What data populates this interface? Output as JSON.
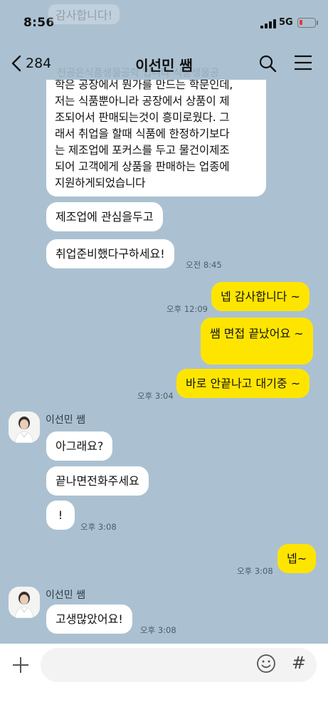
{
  "status_bar": {
    "time": "8:56",
    "network": "5G",
    "notification_ghost": "감사합니다!",
    "colors": {
      "battery_low": "#e53935"
    }
  },
  "header": {
    "back_count": "284",
    "title": "이선민 쌤",
    "overlay_ghost": "전공은식품생물공학 입니다 식품생물공"
  },
  "colors": {
    "background": "#abc1d1",
    "incoming_bubble": "#ffffff",
    "outgoing_bubble": "#fee500"
  },
  "messages": {
    "long_text": [
      "학은 공장에서 뭔가를 만드는 학문인데,",
      "저는 식품뿐아니라 공장에서 상품이 제",
      "조되어서 판매되는것이 흥미로웠다. 그",
      "래서 취업을 할때 식품에 한정하기보다",
      "는 제조업에 포커스를 두고 물건이제조",
      "되어 고객에게 상품을 판매하는 업종에",
      "지원하게되었습니다"
    ],
    "m1": "제조업에 관심을두고",
    "m2": "취업준비했다구하세요!",
    "t1": "오전 8:45",
    "m3": "넵 감사합니다 ~",
    "t2": "오후 12:09",
    "m4": "쌤 면접 끝났어요 ~",
    "m5": "바로 안끝나고 대기중 ~",
    "t3": "오후 3:04",
    "sender1": "이선민 쌤",
    "m6": "아그래요?",
    "m7": "끝나면전화주세요",
    "m8": "!",
    "t4": "오후 3:08",
    "m9": "넵~",
    "t5": "오후 3:08",
    "sender2": "이선민 쌤",
    "m10": "고생많았어요!",
    "t6": "오후 3:08"
  },
  "input": {
    "value": "",
    "placeholder": "",
    "hash_symbol": "#"
  },
  "icons": {
    "back": "chevron-left-icon",
    "search": "search-icon",
    "menu": "menu-icon",
    "plus": "plus-icon",
    "emoji": "emoji-icon",
    "hash": "hash-icon"
  }
}
